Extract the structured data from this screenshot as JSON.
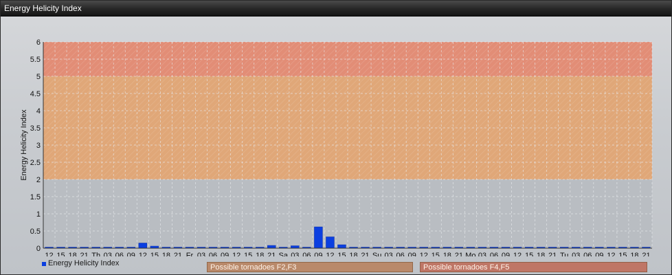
{
  "window": {
    "title": "Energy Helicity Index"
  },
  "colors": {
    "bar": "#0b3fe0",
    "band_high": "#e48a72",
    "band_mid": "#e2a574",
    "plot_bg": "#b9bdc2",
    "grid": "#e9ecef"
  },
  "legend": {
    "series_label": "Energy Helicity Index"
  },
  "bands": [
    {
      "label": "Possible tornadoes F2,F3",
      "from": 2,
      "to": 5
    },
    {
      "label": "Possible tornadoes F4,F5",
      "from": 5,
      "to": 6
    }
  ],
  "chart_data": {
    "type": "bar",
    "title": "",
    "xlabel": "",
    "ylabel": "Energy Helicity Index",
    "ylim": [
      0,
      6
    ],
    "yticks": [
      "0",
      "0.5",
      "1",
      "1.5",
      "2",
      "2.5",
      "3",
      "3.5",
      "4",
      "4.5",
      "5",
      "5.5",
      "6"
    ],
    "grid": true,
    "legend_position": "bottom-left",
    "categories": [
      "12",
      "15",
      "18",
      "21",
      "Th",
      "03",
      "06",
      "09",
      "12",
      "15",
      "18",
      "21",
      "Fr",
      "03",
      "06",
      "09",
      "12",
      "15",
      "18",
      "21",
      "Sa",
      "03",
      "06",
      "09",
      "12",
      "15",
      "18",
      "21",
      "Su",
      "03",
      "06",
      "09",
      "12",
      "15",
      "18",
      "21",
      "Mo",
      "03",
      "06",
      "09",
      "12",
      "15",
      "18",
      "21",
      "Tu",
      "03",
      "06",
      "09",
      "12",
      "15",
      "18",
      "21"
    ],
    "series": [
      {
        "name": "Energy Helicity Index",
        "values": [
          0.02,
          0.02,
          0.02,
          0.02,
          0.02,
          0.02,
          0.02,
          0.02,
          0.15,
          0.06,
          0.03,
          0.03,
          0.02,
          0.03,
          0.02,
          0.02,
          0.02,
          0.03,
          0.03,
          0.08,
          0.03,
          0.07,
          0.03,
          0.62,
          0.33,
          0.1,
          0.02,
          0.02,
          0.02,
          0.02,
          0.02,
          0.02,
          0.02,
          0.02,
          0.02,
          0.02,
          0.02,
          0.02,
          0.02,
          0.02,
          0.02,
          0.02,
          0.02,
          0.02,
          0.02,
          0.02,
          0.02,
          0.02,
          0.02,
          0.02,
          0.02,
          0.02
        ]
      }
    ]
  }
}
